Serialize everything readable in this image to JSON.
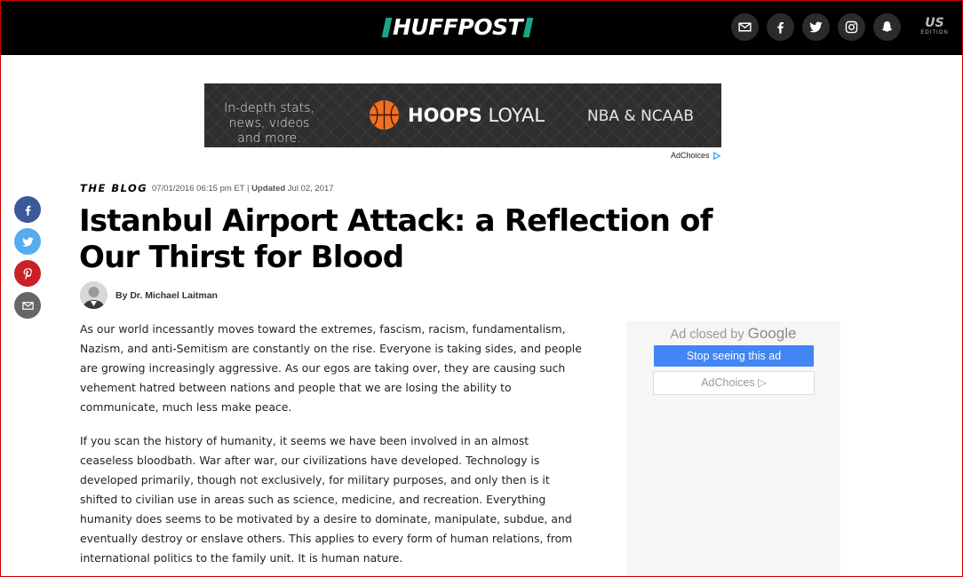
{
  "header": {
    "logo": "HUFFPOST",
    "edition_main": "US",
    "edition_sub": "EDITION",
    "social_icons": [
      "email-icon",
      "facebook-icon",
      "twitter-icon",
      "instagram-icon",
      "snapchat-icon"
    ]
  },
  "top_ad": {
    "tagline": "In-depth stats, news, videos and more.",
    "brand_bold": "HOOPS",
    "brand_light": "LOYAL",
    "leagues": "NBA & NCAAB",
    "adchoices": "AdChoices"
  },
  "share_bar": {
    "icons": [
      "facebook-icon",
      "twitter-icon",
      "pinterest-icon",
      "email-icon"
    ],
    "colors": [
      "#3b5998",
      "#55acee",
      "#cb2027",
      "#666666"
    ]
  },
  "article": {
    "kicker": "THE BLOG",
    "date": "07/01/2016 06:15 pm ET",
    "separator": "|",
    "updated_label": "Updated",
    "updated_date": "Jul 02, 2017",
    "headline": "Istanbul Airport Attack: a Reflection of Our Thirst for Blood",
    "byline": "By Dr. Michael Laitman",
    "paragraphs": [
      "As our world incessantly moves toward the extremes, fascism, racism, fundamentalism, Nazism, and anti-Semitism are constantly on the rise. Everyone is taking sides, and people are growing increasingly aggressive. As our egos are taking over, they are causing such vehement hatred between nations and people that we are losing the ability to communicate, much less make peace.",
      "If you scan the history of humanity, it seems we have been involved in an almost ceaseless bloodbath. War after war, our civilizations have developed. Technology is developed primarily, though not exclusively, for military purposes, and only then is it shifted to civilian use in areas such as science, medicine, and recreation. Everything humanity does seems to be motivated by a desire to dominate, manipulate, subdue, and eventually destroy or enslave others. This applies to every form of human relations, from international politics to the family unit. It is human nature."
    ]
  },
  "side_ad": {
    "closed_text": "Ad closed by",
    "google": "Google",
    "stop_button": "Stop seeing this ad",
    "adchoices": "AdChoices ▷"
  },
  "colors": {
    "header_bg": "#000000",
    "logo_accent": "#18a589",
    "google_blue": "#4285f4",
    "ball_orange": "#f36f21"
  }
}
